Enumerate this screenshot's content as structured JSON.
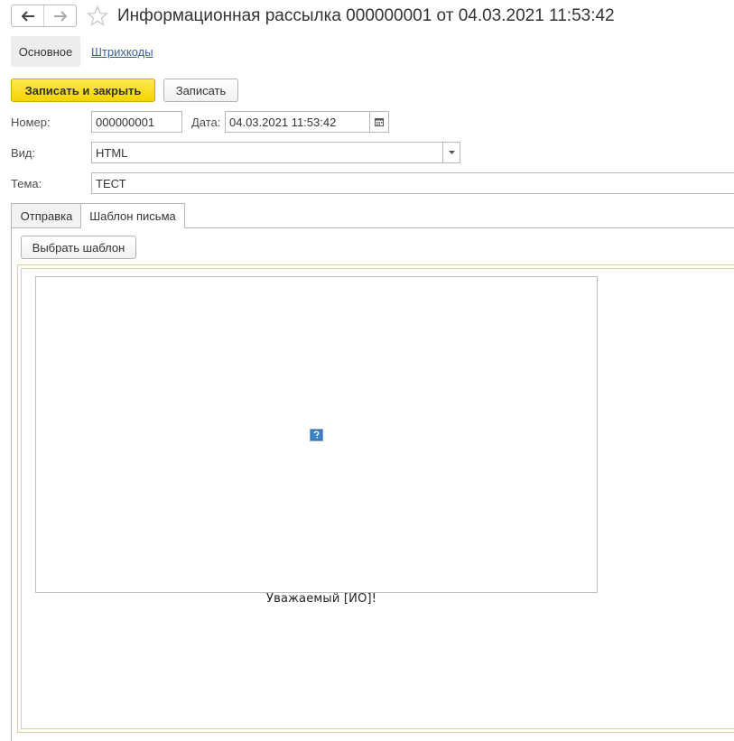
{
  "window": {
    "title": "Информационная рассылка 000000001 от 04.03.2021 11:53:42"
  },
  "page_tabs": {
    "main": "Основное",
    "barcodes": "Штрихкоды"
  },
  "toolbar": {
    "save_close_label": "Записать и закрыть",
    "save_label": "Записать"
  },
  "form": {
    "number_label": "Номер:",
    "number_value": "000000001",
    "date_label": "Дата:",
    "date_value": "04.03.2021 11:53:42",
    "kind_label": "Вид:",
    "kind_value": "HTML",
    "subject_label": "Тема:",
    "subject_value": "ТЕСТ"
  },
  "content_tabs": {
    "send": "Отправка",
    "template": "Шаблон письма"
  },
  "template_panel": {
    "choose_template_label": "Выбрать шаблон",
    "greeting_text": "Уважаемый [ИО]!"
  },
  "colors": {
    "primary_button": "#f5d300",
    "link": "#3a5f9a",
    "frame_border": "#d9d29a"
  },
  "icons": {
    "back": "arrow-left-icon",
    "forward": "arrow-right-icon",
    "favorite": "star-icon",
    "calendar": "calendar-icon",
    "dropdown": "chevron-down-icon",
    "broken_image": "broken-image-icon"
  }
}
